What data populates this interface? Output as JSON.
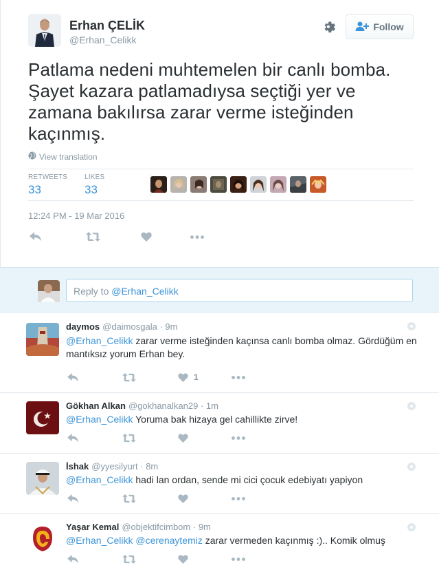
{
  "tweet": {
    "author_name": "Erhan ÇELİK",
    "author_handle": "@Erhan_Celikk",
    "follow_label": "Follow",
    "text": "Patlama nedeni muhtemelen bir canlı bomba. Şayet kazara patlamadıysa seçtiği yer ve zamana bakılırsa zarar verme isteğinden kaçınmış.",
    "view_translation": "View translation",
    "retweets_label": "RETWEETS",
    "retweets_count": "33",
    "likes_label": "LIKES",
    "likes_count": "33",
    "timestamp": "12:24 PM - 19 Mar 2016"
  },
  "reply_box": {
    "prefix": "Reply to ",
    "mention": "@Erhan_Celikk"
  },
  "replies": [
    {
      "name": "daymos",
      "handle": "@daimosgala",
      "time": "9m",
      "mention": "@Erhan_Celikk",
      "text": " zarar verme isteğinden kaçınsa canlı bomba olmaz. Gördüğüm en mantıksız yorum Erhan bey.",
      "like_count": "1"
    },
    {
      "name": "Gökhan Alkan",
      "handle": "@gokhanalkan29",
      "time": "1m",
      "mention": "@Erhan_Celikk",
      "text": " Yoruma bak hizaya gel cahillikte zirve!",
      "like_count": ""
    },
    {
      "name": "İshak",
      "handle": "@yyesilyurt",
      "time": "8m",
      "mention": "@Erhan_Celikk",
      "text": " hadi lan ordan, sende mi cici çocuk edebiyatı yapiyon",
      "like_count": ""
    },
    {
      "name": "Yaşar Kemal",
      "handle": "@objektifcimbom",
      "time": "9m",
      "mention": "@Erhan_Celikk",
      "mention2": "@cerenaytemiz",
      "text": " zarar vermeden kaçınmış :).. Komik olmuş",
      "like_count": ""
    }
  ],
  "colors": {
    "link": "#3b94d9",
    "muted": "#8899a6",
    "action_icon": "#aab8c2",
    "reply_box_bg": "#e8f4f9"
  },
  "icons": [
    "gear-icon",
    "follow-person-icon",
    "globe-icon",
    "reply-icon",
    "retweet-icon",
    "heart-icon",
    "more-icon",
    "caret-icon"
  ]
}
